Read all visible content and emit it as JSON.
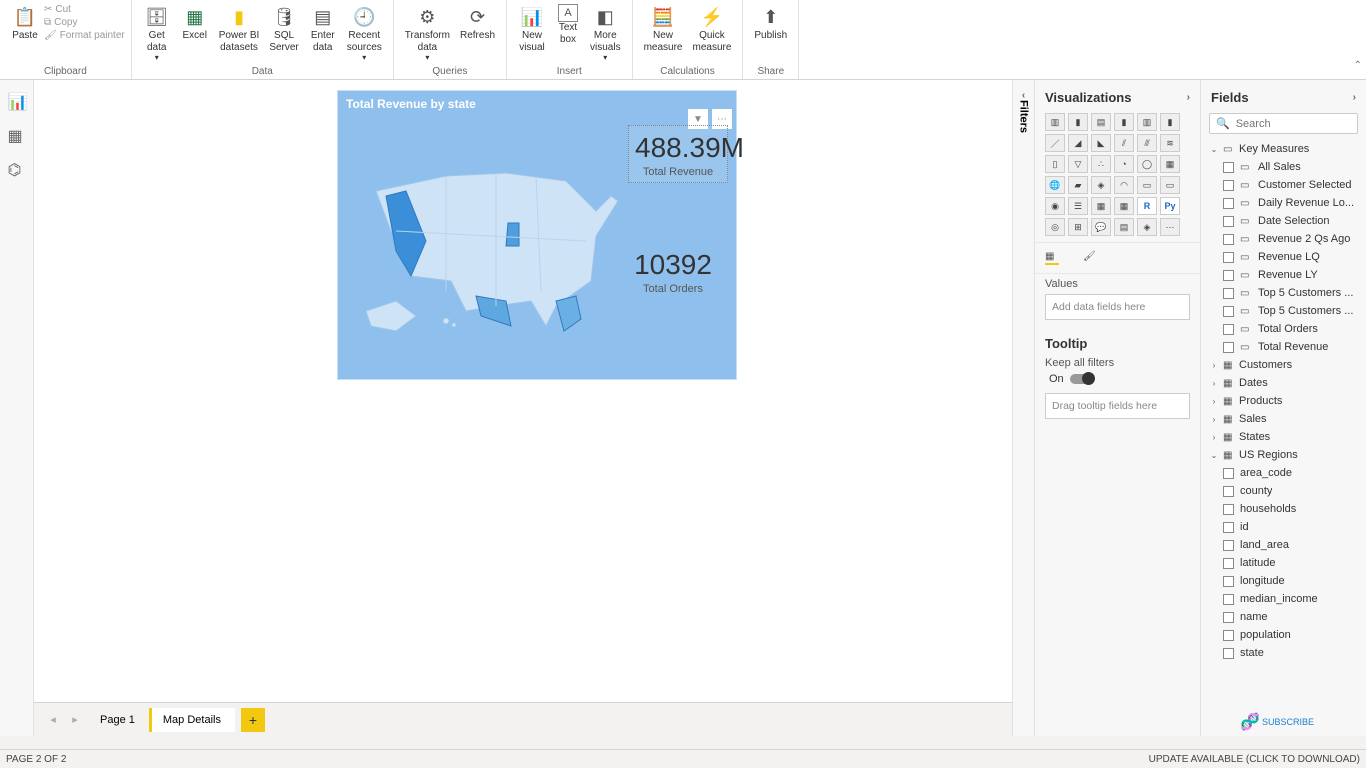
{
  "ribbon": {
    "clipboard": {
      "label": "Clipboard",
      "cut": "Cut",
      "copy": "Copy",
      "paste": "Paste",
      "format": "Format painter"
    },
    "data": {
      "label": "Data",
      "getdata": "Get\ndata",
      "excel": "Excel",
      "pbi": "Power BI\ndatasets",
      "sql": "SQL\nServer",
      "enter": "Enter\ndata",
      "recent": "Recent\nsources"
    },
    "queries": {
      "label": "Queries",
      "transform": "Transform\ndata",
      "refresh": "Refresh"
    },
    "insert": {
      "label": "Insert",
      "newvisual": "New\nvisual",
      "textbox": "Text\nbox",
      "more": "More\nvisuals"
    },
    "calc": {
      "label": "Calculations",
      "newmeasure": "New\nmeasure",
      "quick": "Quick\nmeasure"
    },
    "share": {
      "label": "Share",
      "publish": "Publish"
    }
  },
  "visual": {
    "title": "Total Revenue by state",
    "card1_value": "488.39M",
    "card1_label": "Total Revenue",
    "card2_value": "10392",
    "card2_label": "Total Orders"
  },
  "tabs": {
    "page1": "Page 1",
    "page2": "Map Details"
  },
  "status": {
    "left": "PAGE 2 OF 2",
    "right": "UPDATE AVAILABLE (CLICK TO DOWNLOAD)"
  },
  "vizpanel": {
    "title": "Visualizations",
    "values": "Values",
    "values_ph": "Add data fields here",
    "tooltip": "Tooltip",
    "keep": "Keep all filters",
    "on": "On",
    "tooltip_ph": "Drag tooltip fields here"
  },
  "filters": "Filters",
  "fieldspanel": {
    "title": "Fields",
    "search_ph": "Search",
    "keymeasures": "Key Measures",
    "km": [
      "All Sales",
      "Customer Selected",
      "Daily Revenue Lo...",
      "Date Selection",
      "Revenue 2 Qs Ago",
      "Revenue LQ",
      "Revenue LY",
      "Top 5 Customers ...",
      "Top 5 Customers ...",
      "Total Orders",
      "Total Revenue"
    ],
    "tables": [
      "Customers",
      "Dates",
      "Products",
      "Sales",
      "States"
    ],
    "usregions": "US Regions",
    "ur": [
      "area_code",
      "county",
      "households",
      "id",
      "land_area",
      "latitude",
      "longitude",
      "median_income",
      "name",
      "population",
      "state"
    ]
  },
  "subscribe": "SUBSCRIBE"
}
